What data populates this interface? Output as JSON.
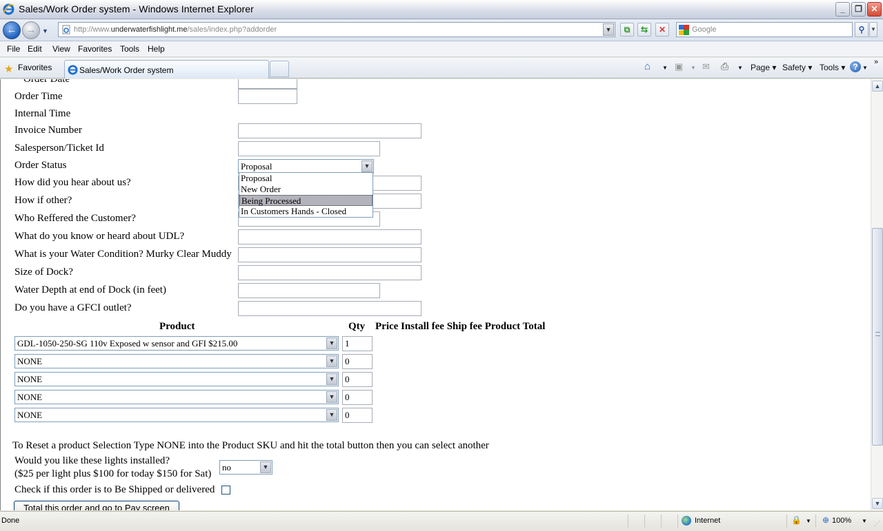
{
  "window": {
    "title": "Sales/Work Order system - Windows Internet Explorer"
  },
  "navbar": {
    "url_prefix": "http://www.",
    "url_domain": "underwaterfishlight.me",
    "url_path": "/sales/index.php?addorder",
    "search_placeholder": "Google"
  },
  "menu": [
    "File",
    "Edit",
    "View",
    "Favorites",
    "Tools",
    "Help"
  ],
  "favbar": {
    "favorites_label": "Favorites",
    "tab_title": "Sales/Work Order system",
    "commands": [
      "Page",
      "Safety",
      "Tools"
    ]
  },
  "form": {
    "fields": [
      {
        "label": "Order Date",
        "value": ""
      },
      {
        "label": "Order Time",
        "value": ""
      },
      {
        "label": "Internal Time",
        "value": ""
      },
      {
        "label": "Invoice Number",
        "value": ""
      },
      {
        "label": "Salesperson/Ticket Id",
        "value": ""
      },
      {
        "label": "Order Status",
        "value": "Proposal"
      },
      {
        "label": "How did you hear about us?",
        "value": ""
      },
      {
        "label": "How if other?",
        "value": ""
      },
      {
        "label": "Who Reffered the Customer?",
        "value": ""
      },
      {
        "label": "What do you know or heard about UDL?",
        "value": ""
      },
      {
        "label": "What is your Water Condition? Murky Clear Muddy",
        "value": ""
      },
      {
        "label": "Size of Dock?",
        "value": ""
      },
      {
        "label": "Water Depth at end of Dock (in feet)",
        "value": ""
      },
      {
        "label": "Do you have a GFCI outlet?",
        "value": ""
      }
    ],
    "order_status_options": [
      "Proposal",
      "New Order",
      "Being Processed",
      "In Customers Hands - Closed"
    ],
    "order_status_highlighted": "Being Processed"
  },
  "products": {
    "headers": {
      "product": "Product",
      "qty": "Qty",
      "rest": "Price Install fee Ship fee Product Total"
    },
    "rows": [
      {
        "product": "GDL-1050-250-SG 110v Exposed w sensor and GFI $215.00",
        "qty": "1"
      },
      {
        "product": "NONE",
        "qty": "0"
      },
      {
        "product": "NONE",
        "qty": "0"
      },
      {
        "product": "NONE",
        "qty": "0"
      },
      {
        "product": "NONE",
        "qty": "0"
      }
    ]
  },
  "footer": {
    "reset_note": "To Reset a product Selection Type NONE into the Product SKU and hit the total button then you can select another",
    "install_question": "Would you like these lights installed?",
    "install_pricing": "($25 per light plus $100 for today $150 for Sat)",
    "install_value": "no",
    "ship_label": "Check if this order is to Be Shipped or delivered",
    "ship_checked": false,
    "total_button": "Total this order and go to Pay screen"
  },
  "status": {
    "text": "Done",
    "zone": "Internet",
    "zoom": "100%"
  }
}
